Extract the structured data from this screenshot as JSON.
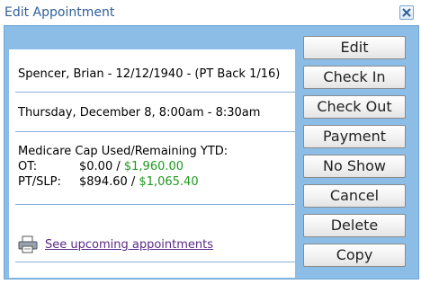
{
  "window": {
    "title": "Edit Appointment",
    "close_icon": "close-x-icon"
  },
  "details": {
    "patient_line": "Spencer, Brian - 12/12/1940 - (PT Back 1/16)",
    "time_line": "Thursday, December 8, 8:00am - 8:30am",
    "cap_heading": "Medicare Cap Used/Remaining YTD:",
    "cap_rows": [
      {
        "label": "OT:",
        "used": "$0.00",
        "sep": " / ",
        "remaining": "$1,960.00"
      },
      {
        "label": "PT/SLP:",
        "used": "$894.60",
        "sep": " / ",
        "remaining": "$1,065.40"
      }
    ],
    "link_text": "See upcoming appointments",
    "link_icon": "printer-icon"
  },
  "buttons": [
    "Edit",
    "Check In",
    "Check Out",
    "Payment",
    "No Show",
    "Cancel",
    "Delete",
    "Copy"
  ],
  "colors": {
    "accent": "#2f5f99",
    "body_bg": "#8bbde6",
    "remaining_green": "#1f9a1f",
    "link": "#5a2a86"
  }
}
